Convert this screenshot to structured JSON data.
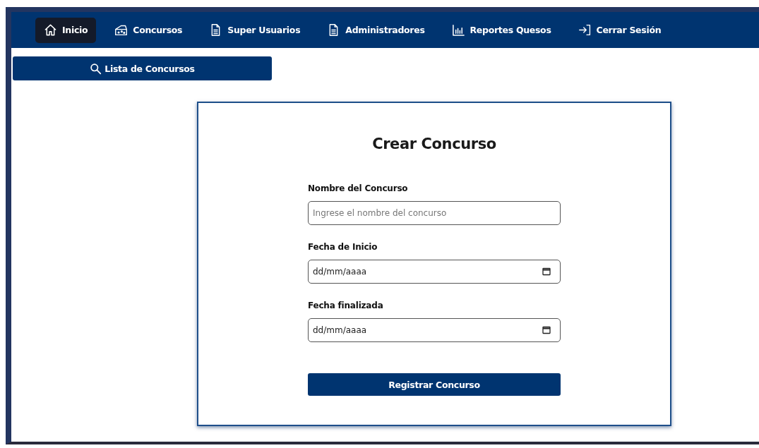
{
  "nav": {
    "items": [
      {
        "label": "Inicio",
        "selected": true
      },
      {
        "label": "Concursos",
        "selected": false
      },
      {
        "label": "Super Usuarios",
        "selected": false
      },
      {
        "label": "Administradores",
        "selected": false
      },
      {
        "label": "Reportes Quesos",
        "selected": false
      },
      {
        "label": "Cerrar Sesión",
        "selected": false
      }
    ]
  },
  "list_button": {
    "label": "Lista de Concursos"
  },
  "form": {
    "title": "Crear Concurso",
    "fields": [
      {
        "kind": "text",
        "label": "Nombre del Concurso",
        "placeholder": "Ingrese el nombre del concurso"
      },
      {
        "kind": "date",
        "label": "Fecha de Inicio",
        "placeholder": "dd/mm/aaaa"
      },
      {
        "kind": "date",
        "label": "Fecha finalizada",
        "placeholder": "dd/mm/aaaa"
      }
    ],
    "submit": "Registrar Concurso"
  }
}
